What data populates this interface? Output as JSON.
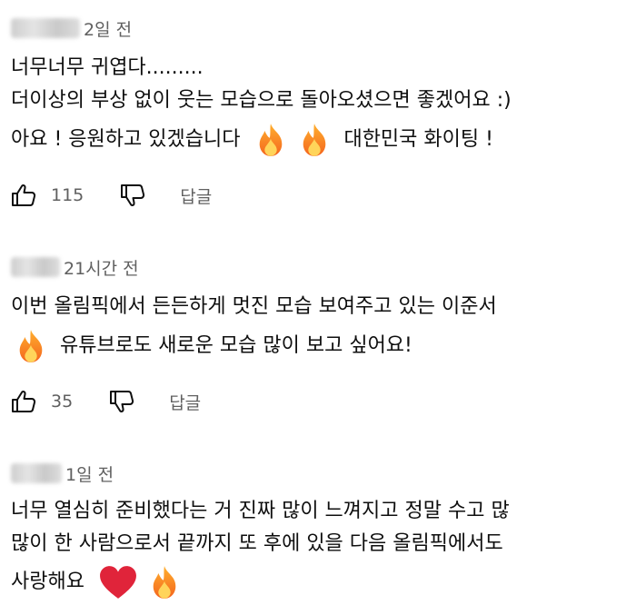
{
  "comments": [
    {
      "time": "2일 전",
      "lines": [
        "너무너무 귀엽다.........",
        "더이상의 부상 없이 웃는 모습으로 돌아오셨으면 좋겠어요 :)",
        "아요 ! 응원하고 있겠습니다",
        "대한민국 화이팅 !"
      ],
      "likes": "115",
      "reply_label": "답글"
    },
    {
      "time": "21시간 전",
      "lines": [
        "이번 올림픽에서 든든하게 멋진 모습 보여주고 있는 이준서",
        "유튜브로도 새로운 모습 많이 보고 싶어요!"
      ],
      "likes": "35",
      "reply_label": "답글"
    },
    {
      "time": "1일 전",
      "lines": [
        "너무 열심히 준비했다는 거 진짜 많이 느껴지고 정말 수고 많",
        "많이 한 사람으로서 끝까지 또 후에 있을 다음 올림픽에서도",
        "사랑해요"
      ]
    }
  ],
  "icons": [
    "thumbs-up-icon",
    "thumbs-down-icon",
    "fire-emoji",
    "red-heart-emoji"
  ],
  "colors": {
    "text": "#0f0f0f",
    "meta": "#606060",
    "fire": "#f7841e",
    "heart": "#e0243a"
  }
}
